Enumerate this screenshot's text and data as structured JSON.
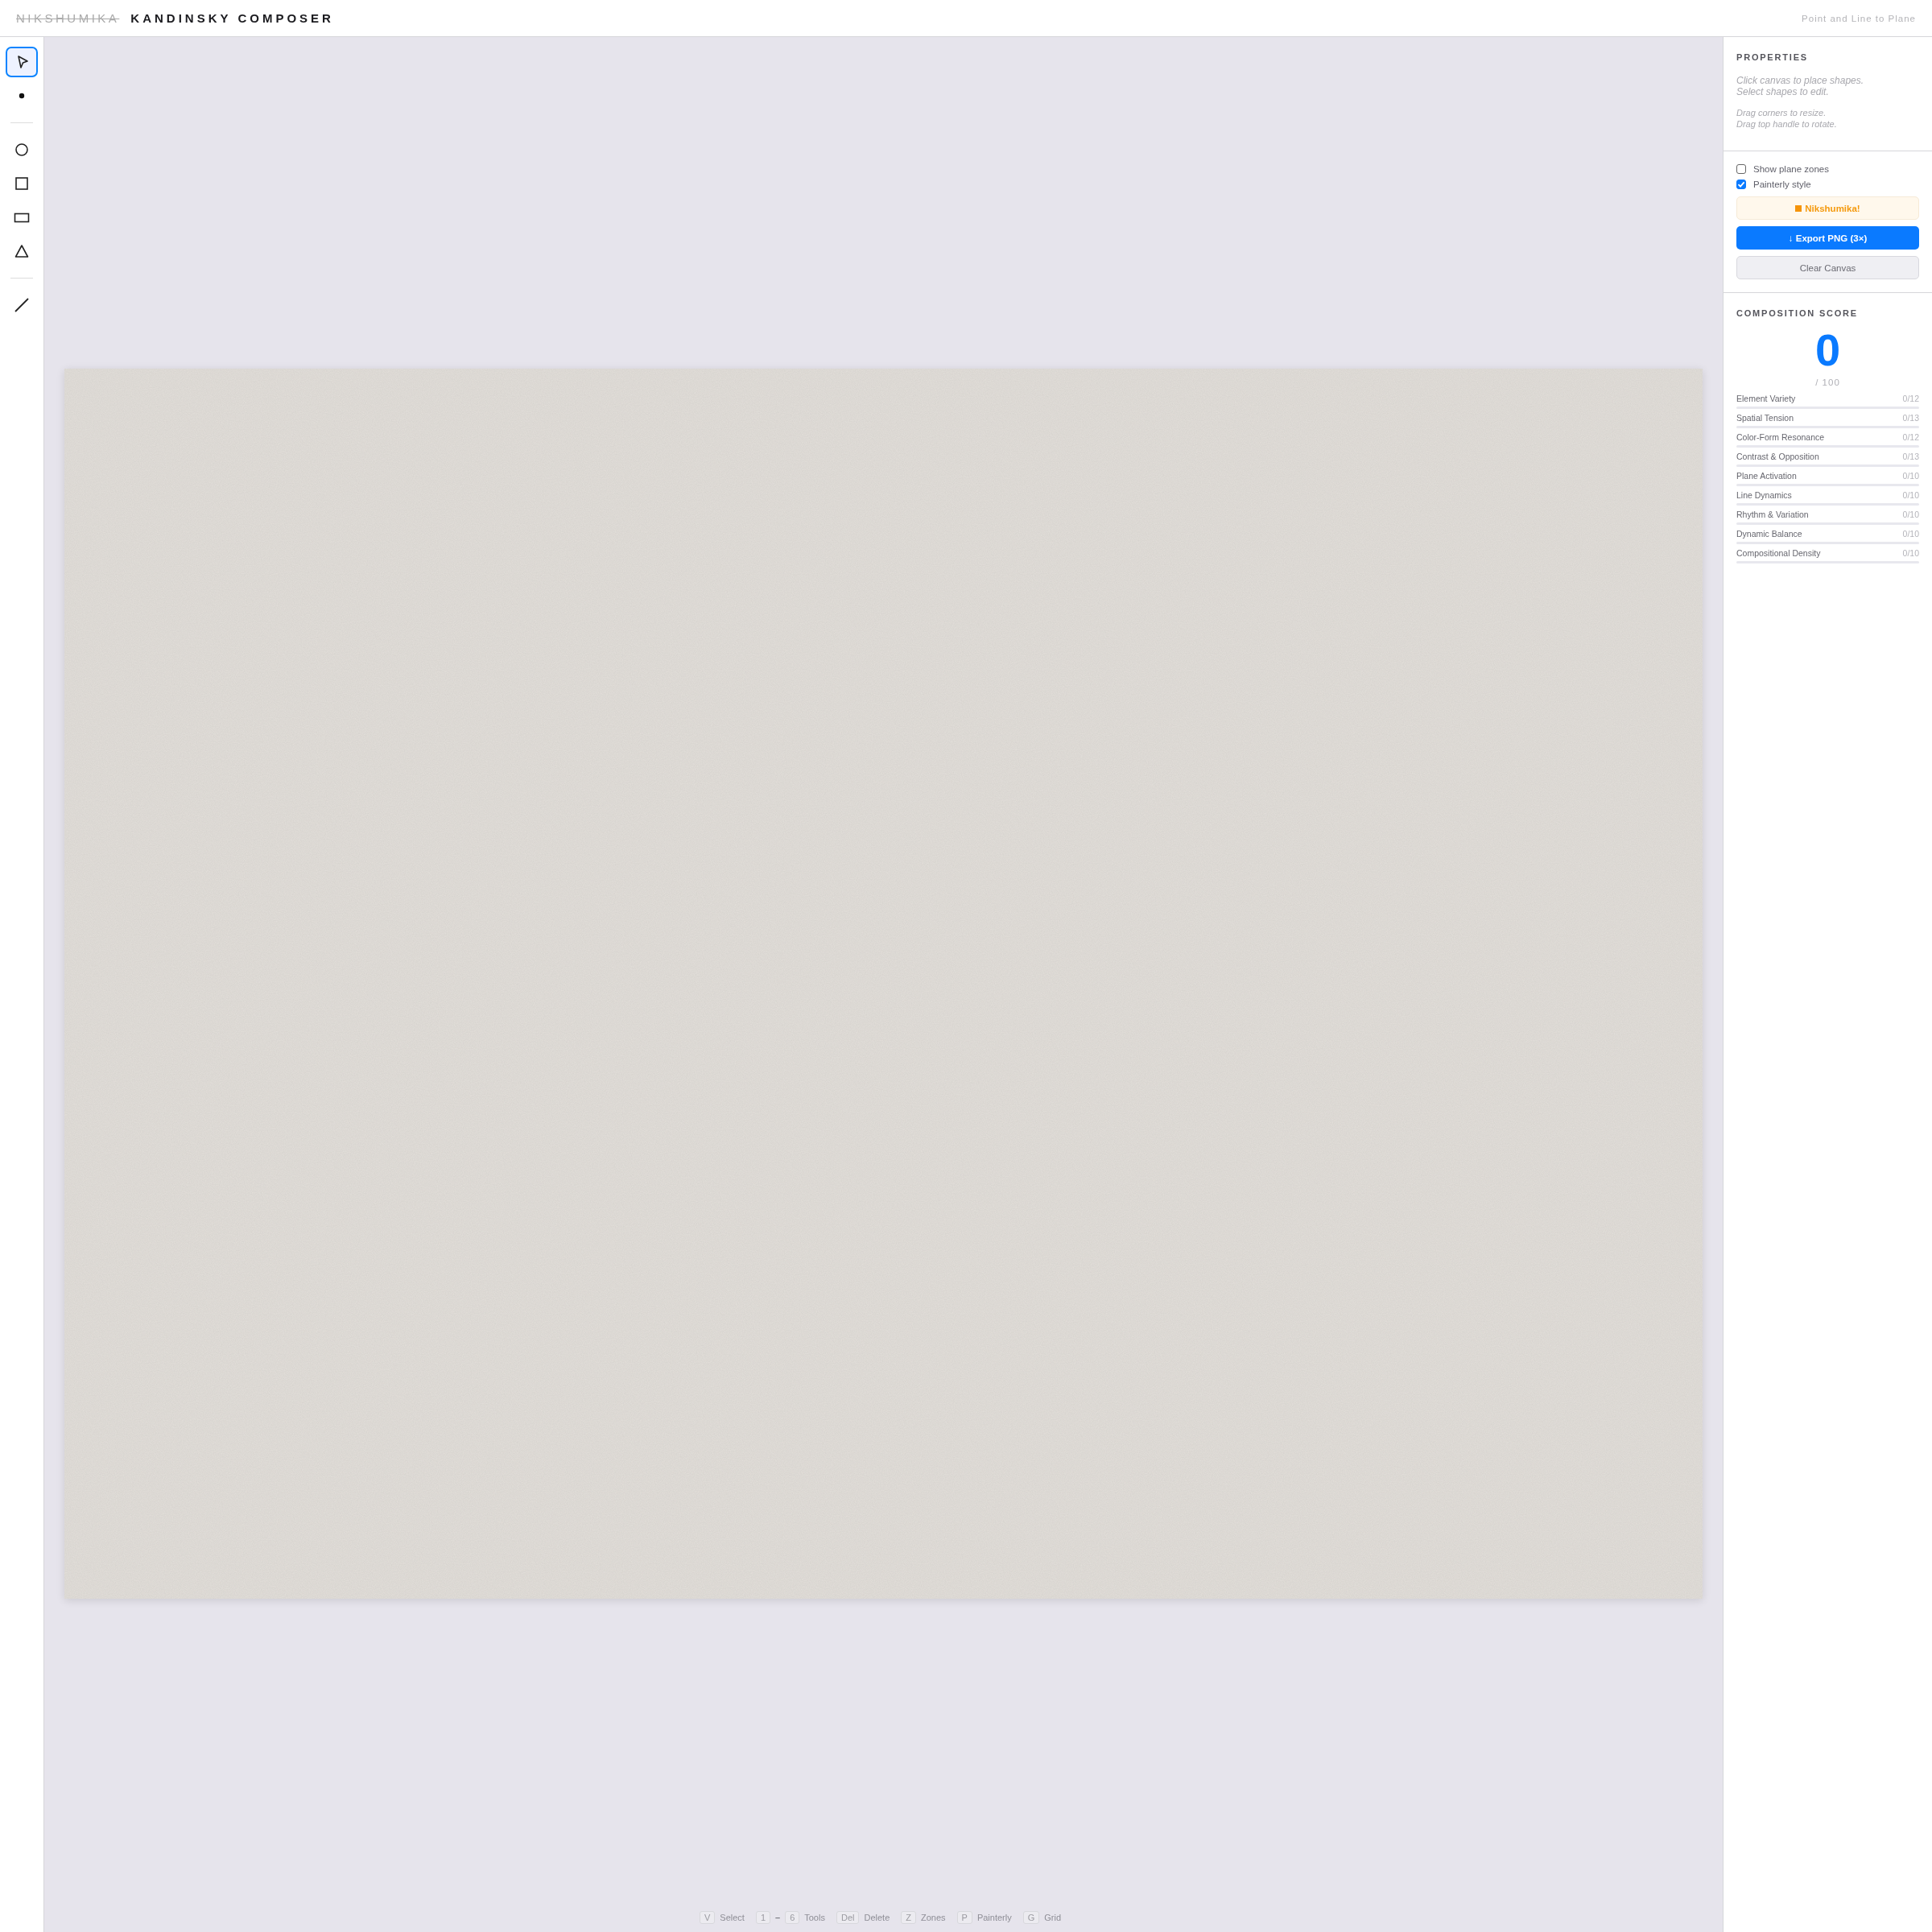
{
  "header": {
    "brand": "NIKSHUMIKA",
    "title": "KANDINSKY COMPOSER",
    "subtitle": "Point and Line to Plane"
  },
  "toolbar": {
    "groups": [
      [
        {
          "kind": "select",
          "selected": true
        },
        {
          "kind": "point",
          "selected": false
        }
      ],
      [
        {
          "kind": "circle",
          "selected": false
        },
        {
          "kind": "square",
          "selected": false
        },
        {
          "kind": "rectangle",
          "selected": false
        },
        {
          "kind": "triangle",
          "selected": false
        }
      ],
      [
        {
          "kind": "line",
          "selected": false
        }
      ]
    ]
  },
  "properties": {
    "title": "PROPERTIES",
    "hints": [
      "Click canvas to place shapes.\nSelect shapes to edit.",
      "Drag corners to resize.\nDrag top handle to rotate."
    ]
  },
  "options": [
    {
      "label": "Show plane zones",
      "checked": false
    },
    {
      "label": "Painterly style",
      "checked": true
    }
  ],
  "buttons": [
    {
      "kind": "accent",
      "label": "Nikshumika!"
    },
    {
      "kind": "primary",
      "label": "↓ Export PNG (3×)"
    },
    {
      "kind": "secondary",
      "label": "Clear Canvas"
    }
  ],
  "score": {
    "title": "COMPOSITION SCORE",
    "value": "0",
    "out_of": "/ 100",
    "criteria": [
      {
        "name": "Element Variety",
        "reading": "0/12",
        "level": 0
      },
      {
        "name": "Spatial Tension",
        "reading": "0/13",
        "level": 0
      },
      {
        "name": "Color-Form Resonance",
        "reading": "0/12",
        "level": 0
      },
      {
        "name": "Contrast & Opposition",
        "reading": "0/13",
        "level": 0
      },
      {
        "name": "Plane Activation",
        "reading": "0/10",
        "level": 0
      },
      {
        "name": "Line Dynamics",
        "reading": "0/10",
        "level": 0
      },
      {
        "name": "Rhythm & Variation",
        "reading": "0/10",
        "level": 0
      },
      {
        "name": "Dynamic Balance",
        "reading": "0/10",
        "level": 0
      },
      {
        "name": "Compositional Density",
        "reading": "0/10",
        "level": 0
      }
    ]
  },
  "shortcuts": [
    {
      "keys": [
        "V"
      ],
      "label": "Select"
    },
    {
      "keys": [
        "1",
        "6"
      ],
      "separator": "–",
      "label": "Tools"
    },
    {
      "keys": [
        "Del"
      ],
      "label": "Delete"
    },
    {
      "keys": [
        "Z"
      ],
      "label": "Zones"
    },
    {
      "keys": [
        "P"
      ],
      "label": "Painterly"
    },
    {
      "keys": [
        "G"
      ],
      "label": "Grid"
    }
  ]
}
